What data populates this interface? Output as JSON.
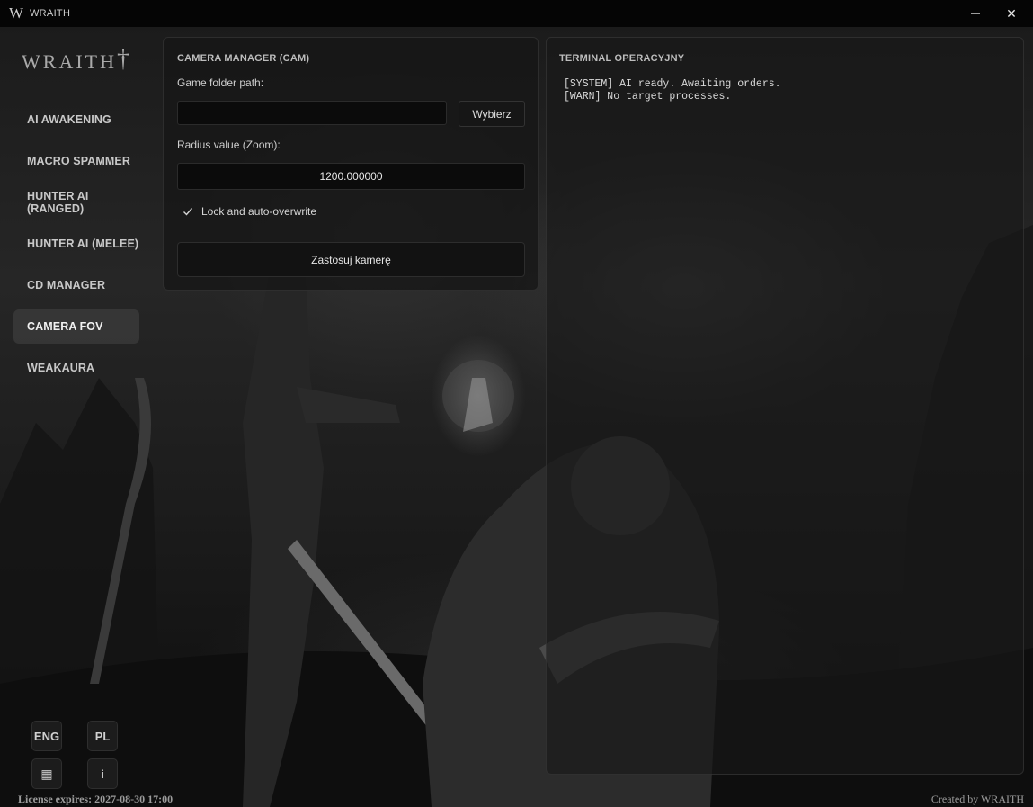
{
  "window": {
    "logo": "W",
    "title": "WRAITH",
    "minimize_glyph": "—",
    "close_glyph": "✕"
  },
  "sidebar": {
    "brand": "WRAITH",
    "brand_mark": "†",
    "items": [
      {
        "label": "AI AWAKENING",
        "active": false
      },
      {
        "label": "MACRO SPAMMER",
        "active": false
      },
      {
        "label": "HUNTER AI (RANGED)",
        "active": false
      },
      {
        "label": "HUNTER AI (MELEE)",
        "active": false
      },
      {
        "label": "CD MANAGER",
        "active": false
      },
      {
        "label": "CAMERA FOV",
        "active": true
      },
      {
        "label": "WEAKAURA",
        "active": false
      }
    ],
    "lang_eng": "ENG",
    "lang_pl": "PL",
    "grid_icon": "▦",
    "info_label": "i"
  },
  "camera_panel": {
    "title": "CAMERA MANAGER (CAM)",
    "folder_label": "Game folder path:",
    "folder_value": "",
    "choose_button": "Wybierz",
    "zoom_label": "Radius value (Zoom):",
    "zoom_value": "1200.000000",
    "lock_checked": true,
    "lock_label": "Lock and auto-overwrite",
    "apply_button": "Zastosuj kamerę"
  },
  "terminal": {
    "title": "TERMINAL OPERACYJNY",
    "lines": [
      "[SYSTEM] AI ready. Awaiting orders.",
      "[WARN] No target processes."
    ]
  },
  "footer": {
    "license": "License expires: 2027-08-30 17:00",
    "created": "Created by WRAITH"
  }
}
